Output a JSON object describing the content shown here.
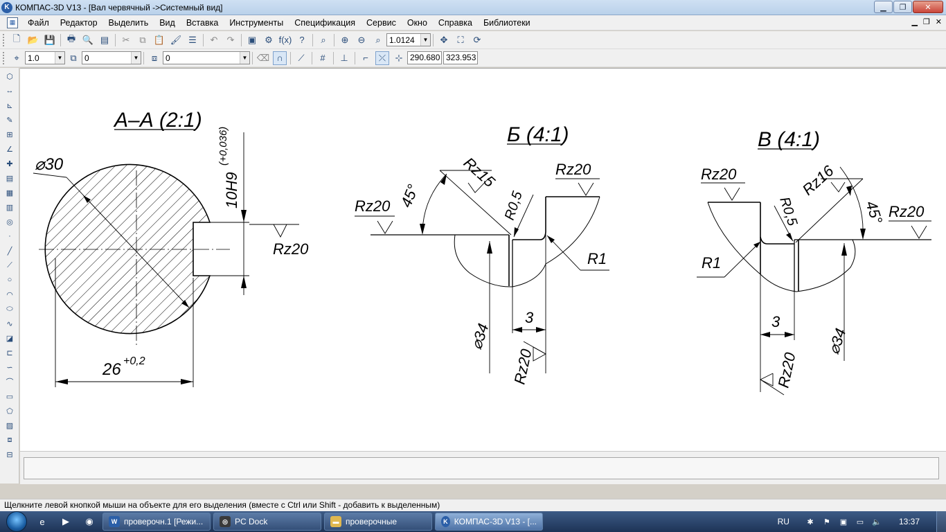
{
  "window": {
    "title": "КОМПАС-3D V13 - [Вал червячный ->Системный вид]",
    "app_icon": "kompas-logo-icon"
  },
  "menu": {
    "items": [
      "Файл",
      "Редактор",
      "Выделить",
      "Вид",
      "Вставка",
      "Инструменты",
      "Спецификация",
      "Сервис",
      "Окно",
      "Справка",
      "Библиотеки"
    ]
  },
  "toolbar1": {
    "zoom_value": "1.0124"
  },
  "toolbar2": {
    "step_value": "1.0",
    "layer_value": "0",
    "style_value": "0",
    "coord_x": "290.680",
    "coord_y": "323.953"
  },
  "drawing": {
    "section_aa": {
      "title": "А–А (2:1)",
      "diameter_label": "⌀30",
      "width_dim": "26",
      "width_tol": "+0,2",
      "keyway_dim": "10H9",
      "keyway_tol": "(+0,036)",
      "roughness": "Rz20"
    },
    "detail_b": {
      "title": "Б (4:1)",
      "angle": "45°",
      "rz15": "Rz15",
      "rz20_top": "Rz20",
      "rz20_left": "Rz20",
      "r05": "R0,5",
      "r1": "R1",
      "dim3": "3",
      "dia34": "⌀34",
      "rz20_bottom": "Rz20"
    },
    "detail_v": {
      "title": "В (4:1)",
      "rz20_left": "Rz20",
      "r05": "R0,5",
      "rz16": "Rz16",
      "angle": "45°",
      "rz20_right": "Rz20",
      "r1": "R1",
      "dim3": "3",
      "dia34": "⌀34",
      "rz20_bottom": "Rz20"
    }
  },
  "status": {
    "text": "Щелкните левой кнопкой мыши на объекте для его выделения (вместе с Ctrl или Shift - добавить к выделенным)"
  },
  "taskbar": {
    "items": [
      {
        "label": "проверочн.1 [Режи...",
        "icon": "word-icon"
      },
      {
        "label": "PC Dock",
        "icon": "pcdock-icon"
      },
      {
        "label": "проверочные",
        "icon": "folder-icon"
      },
      {
        "label": "КОМПАС-3D V13 - [...",
        "icon": "kompas-icon"
      }
    ],
    "lang": "RU",
    "clock": "13:37"
  }
}
